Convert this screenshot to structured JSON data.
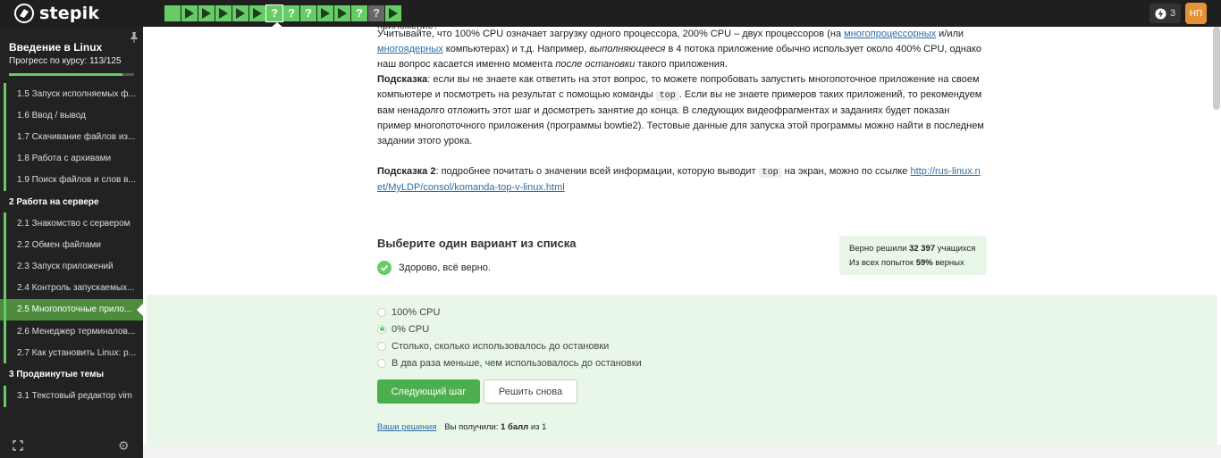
{
  "header": {
    "logo_text": "stepik",
    "steps": [
      {
        "type": "done"
      },
      {
        "type": "done",
        "icon": "play"
      },
      {
        "type": "done",
        "icon": "play"
      },
      {
        "type": "done",
        "icon": "play"
      },
      {
        "type": "done",
        "icon": "play"
      },
      {
        "type": "done",
        "icon": "play"
      },
      {
        "type": "active",
        "icon": "question"
      },
      {
        "type": "done",
        "icon": "question"
      },
      {
        "type": "done",
        "icon": "question"
      },
      {
        "type": "done",
        "icon": "play"
      },
      {
        "type": "done",
        "icon": "play"
      },
      {
        "type": "done",
        "icon": "question"
      },
      {
        "type": "unseen",
        "icon": "question"
      },
      {
        "type": "done",
        "icon": "play"
      }
    ],
    "notifications_count": "3",
    "avatar_initials": "НП"
  },
  "sidebar": {
    "course_title": "Введение в Linux",
    "progress_label": "Прогресс по курсу:  113/125",
    "progress_fraction": 0.904,
    "lessons": [
      {
        "label": "1.5  Запуск исполняемых ф...",
        "kind": "lesson"
      },
      {
        "label": "1.6  Ввод / вывод",
        "kind": "lesson"
      },
      {
        "label": "1.7  Скачивание файлов из...",
        "kind": "lesson"
      },
      {
        "label": "1.8  Работа с архивами",
        "kind": "lesson"
      },
      {
        "label": "1.9  Поиск файлов и слов в...",
        "kind": "lesson"
      },
      {
        "label": "2  Работа на сервере",
        "kind": "section"
      },
      {
        "label": "2.1  Знакомство с сервером",
        "kind": "lesson"
      },
      {
        "label": "2.2  Обмен файлами",
        "kind": "lesson"
      },
      {
        "label": "2.3  Запуск приложений",
        "kind": "lesson"
      },
      {
        "label": "2.4  Контроль запускаемых...",
        "kind": "lesson"
      },
      {
        "label": "2.5  Многопоточные прило...",
        "kind": "current"
      },
      {
        "label": "2.6  Менеджер терминалов...",
        "kind": "lesson"
      },
      {
        "label": "2.7  Как установить Linux: р...",
        "kind": "lesson"
      },
      {
        "label": "3  Продвинутые темы",
        "kind": "section"
      },
      {
        "label": "3.1  Текстовый редактор vim",
        "kind": "lesson"
      }
    ]
  },
  "content": {
    "cut_line": "приложение?",
    "para1_a": "Учитывайте, что 100% CPU означает загрузку одного процессора, 200% CPU – двух процессоров (на ",
    "para1_link1": "многопроцессорных",
    "para1_b": " и/или ",
    "para1_link2": "многоядерных",
    "para1_c": " компьютерах) и т.д. Например, ",
    "para1_em1": "выполняющееся",
    "para1_d": " в 4 потока приложение обычно использует около 400% CPU, однако наш вопрос касается именно момента ",
    "para1_em2": "после остановки",
    "para1_e": " такого приложения.",
    "hint1_label": "Подсказка",
    "hint1_a": ": если вы не знаете как ответить на этот вопрос, то можете попробовать запустить многопоточное приложение на своем компьютере и посмотреть на результат с помощью команды ",
    "hint1_code": "top",
    "hint1_b": ". Если вы не знаете примеров таких приложений, то рекомендуем вам ненадолго отложить этот шаг и досмотреть занятие до конца. В следующих видеофрагментах и заданиях будет показан пример многопоточного приложения (программы bowtie2). Тестовые данные для запуска этой программы можно найти в последнем задании этого урока.",
    "hint2_label": "Подсказка 2",
    "hint2_a": ": подробнее почитать о значении всей информации, которую выводит ",
    "hint2_code": "top",
    "hint2_b": " на экран, можно по ссылке ",
    "hint2_link": "http://rus-linux.net/MyLDP/consol/komanda-top-v-linux.html"
  },
  "quiz": {
    "title": "Выберите один вариант из списка",
    "status_text": "Здорово, всё верно.",
    "stats_line1_a": "Верно решили ",
    "stats_line1_num": "32 397",
    "stats_line1_b": " учащихся",
    "stats_line2_a": "Из всех попыток ",
    "stats_line2_num": "59%",
    "stats_line2_b": " верных",
    "options": [
      {
        "label": "100% CPU",
        "checked": false
      },
      {
        "label": "0% CPU",
        "checked": true
      },
      {
        "label": "Столько, сколько использовалось до остановки",
        "checked": false
      },
      {
        "label": "В два раза меньше, чем использовалось до остановки",
        "checked": false
      }
    ],
    "next_label": "Следующий шаг",
    "retry_label": "Решить снова",
    "solutions_link": "Ваши решения",
    "score_a": "Вы получили: ",
    "score_bold": "1 балл",
    "score_b": " из 1"
  }
}
